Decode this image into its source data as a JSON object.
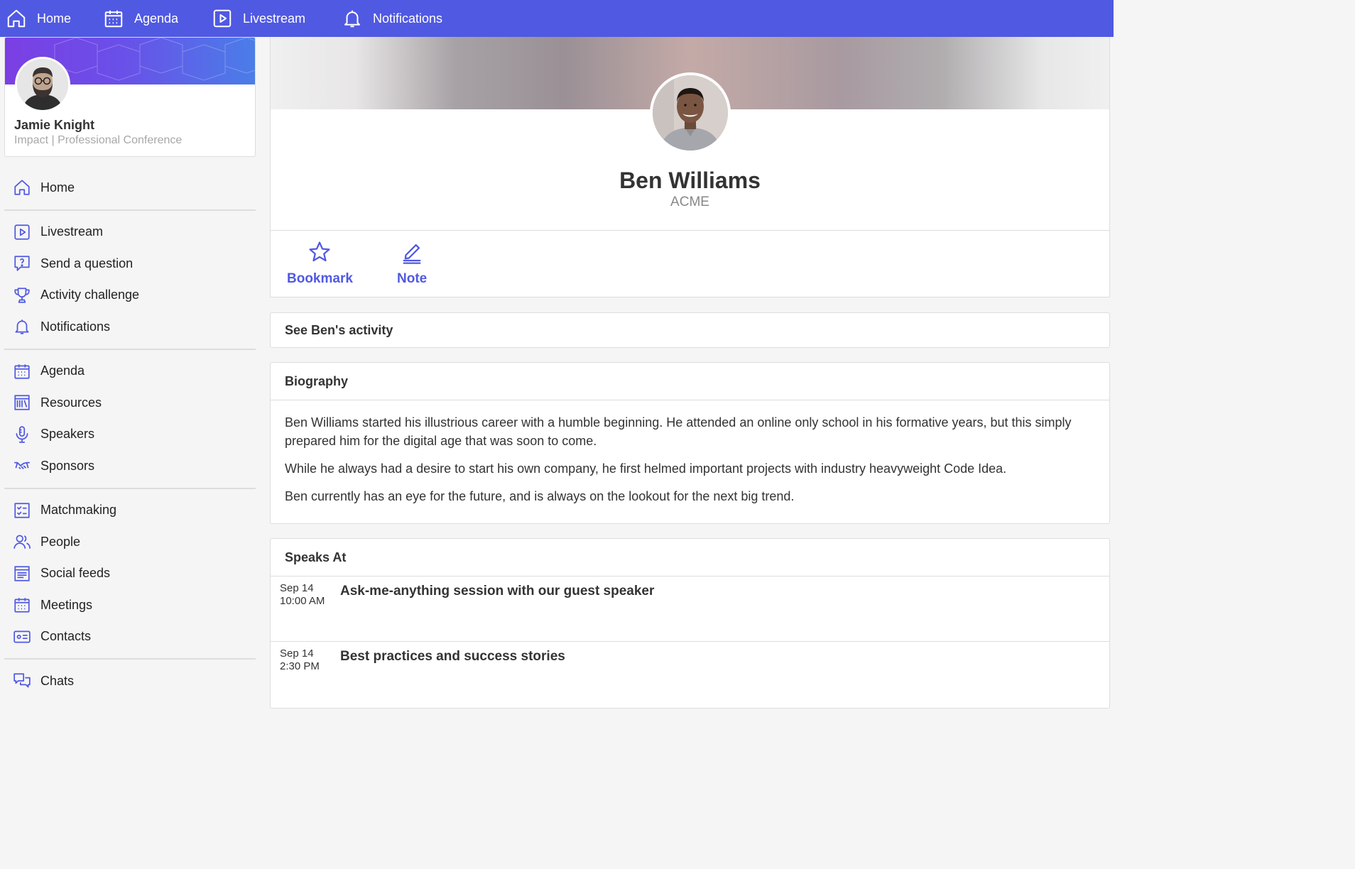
{
  "topnav": [
    {
      "label": "Home",
      "icon": "home-icon"
    },
    {
      "label": "Agenda",
      "icon": "calendar-icon"
    },
    {
      "label": "Livestream",
      "icon": "play-icon"
    },
    {
      "label": "Notifications",
      "icon": "bell-icon"
    }
  ],
  "profile": {
    "name": "Jamie Knight",
    "subtitle": "Impact | Professional Conference"
  },
  "sidebar": {
    "groups": [
      [
        {
          "label": "Home",
          "icon": "home-icon"
        }
      ],
      [
        {
          "label": "Livestream",
          "icon": "play-icon"
        },
        {
          "label": "Send a question",
          "icon": "question-icon"
        },
        {
          "label": "Activity challenge",
          "icon": "trophy-icon"
        },
        {
          "label": "Notifications",
          "icon": "bell-icon"
        }
      ],
      [
        {
          "label": "Agenda",
          "icon": "calendar-icon"
        },
        {
          "label": "Resources",
          "icon": "library-icon"
        },
        {
          "label": "Speakers",
          "icon": "microphone-icon"
        },
        {
          "label": "Sponsors",
          "icon": "handshake-icon"
        }
      ],
      [
        {
          "label": "Matchmaking",
          "icon": "checklist-icon"
        },
        {
          "label": "People",
          "icon": "people-icon"
        },
        {
          "label": "Social feeds",
          "icon": "feed-icon"
        },
        {
          "label": "Meetings",
          "icon": "calendar-icon"
        },
        {
          "label": "Contacts",
          "icon": "id-card-icon"
        }
      ],
      [
        {
          "label": "Chats",
          "icon": "chat-icon"
        }
      ]
    ]
  },
  "speaker": {
    "name": "Ben Williams",
    "company": "ACME"
  },
  "actions": {
    "bookmark": "Bookmark",
    "note": "Note"
  },
  "activity": {
    "label": "See Ben's activity"
  },
  "biography": {
    "title": "Biography",
    "paragraphs": [
      "Ben Williams started his illustrious career with a humble beginning. He attended an online only school in his formative years, but this simply prepared him for the digital age that was soon to come.",
      "While he always had a desire to start his own company, he first helmed important projects with industry heavyweight Code Idea.",
      "Ben currently has an eye for the future, and is always on the lookout for the next big trend."
    ]
  },
  "speaks_at": {
    "title": "Speaks At",
    "sessions": [
      {
        "date": "Sep 14",
        "time": "10:00 AM",
        "title": "Ask-me-anything session with our guest speaker"
      },
      {
        "date": "Sep 14",
        "time": "2:30 PM",
        "title": "Best practices and success stories"
      }
    ]
  },
  "colors": {
    "accent": "#5059e2",
    "border": "#dddddd",
    "background": "#f5f5f5"
  }
}
